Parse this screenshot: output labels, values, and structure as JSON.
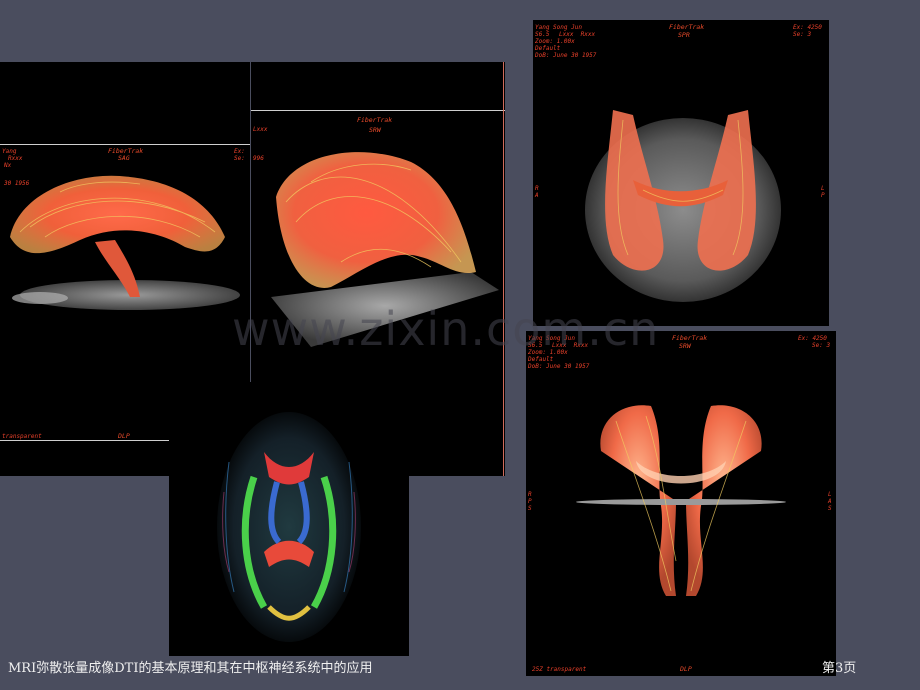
{
  "overlays": {
    "software": "FiberTrak",
    "view_sag": "SAG",
    "view_sag_alt": "SRW",
    "view_spr": "SPR",
    "name_a": "Yang Song Jun",
    "name_b": "Yang Song Jun",
    "name_short": "Yang",
    "ser_a": "S6.5",
    "ser_b": "S6.5",
    "lxxx": "Lxxx  Rxxx",
    "lxxx_short": "Rxxx",
    "ex_a": "Ex: 4250",
    "se_a": "Se: 3",
    "se_b": "Se: 3",
    "se_cut": "Se:",
    "ex_cut": "Ex:",
    "zoom": "Zoom: 1.00x",
    "default": "Default",
    "dob": "DoB: June 30 1957",
    "dob_cut": "30 1956",
    "dob_cut2": "996",
    "transparent": "transparent",
    "transparent_b": "25Z transparent",
    "dlp": "DLP",
    "lxxx_cut": "Lxxx",
    "r_side": "R\nA",
    "l_side": "L\nP",
    "r_side_b": "R\nP\nS",
    "l_side_b": "L\nA\nS",
    "nx": "Nx"
  },
  "watermark": "www.zixin.com.cn",
  "footer": {
    "title": "MRI弥散张量成像DTI的基本原理和其在中枢神经系统中的应用",
    "page": "第3页"
  }
}
